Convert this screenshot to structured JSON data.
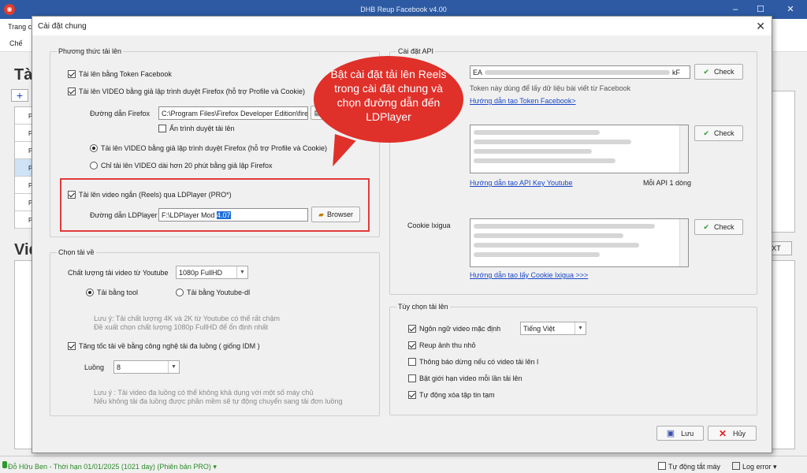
{
  "app": {
    "title": "DHB Reup Facebook v4.00",
    "menu_label": "Trang ch",
    "toolbar_label": "Chế",
    "big_title_1": "Tài",
    "big_title_2": "Vide",
    "left_rows": [
      "P",
      "Pa",
      "Pa",
      "Pa",
      "Pa",
      "Pa",
      "Pa"
    ],
    "right_button_label": "XT"
  },
  "dialog": {
    "title": "Cài đặt chung",
    "upload_method": {
      "group_label": "Phương thức tải lên",
      "token_facebook": "Tải lên bằng Token Facebook",
      "firefox_emulation": "Tải lên VIDEO bằng giả lập trình duyệt Firefox (hỗ trợ Profile và Cookie)",
      "firefox_path_label": "Đường dẫn Firefox",
      "firefox_path_value": "C:\\Program Files\\Firefox Developer Edition\\fire",
      "hide_browser": "Ẩn trình duyệt tải lên",
      "radio_all": "Tải lên VIDEO bằng giả lập trình duyệt Firefox (hỗ trợ Profile và Cookie)",
      "radio_short": "Chỉ tải lên VIDEO dài hơn 20 phút bằng giả lập Firefox",
      "reels_ldplayer": "Tải lên video ngắn (Reels) qua LDPlayer (PRO*)",
      "ldplayer_path_label": "Đường dẫn LDPlayer",
      "ldplayer_path_prefix": "F:\\LDPlayer Mod ",
      "ldplayer_path_selected": "4.07",
      "browser_button": "Browser"
    },
    "download": {
      "group_label": "Chọn tải về",
      "quality_label": "Chất lượng tải video từ Youtube",
      "quality_value": "1080p FullHD",
      "radio_tool": "Tải bằng tool",
      "radio_ytdl": "Tải bằng Youtube-dl",
      "note1_line1": "Lưu ý: Tải chất lượng 4K và 2K từ Youtube có thể rất chậm",
      "note1_line2": "Đề xuất chọn chất lượng 1080p FullHD để ổn định nhất",
      "multithread": "Tăng tốc tải về bằng công nghệ tải đa luồng ( giống IDM )",
      "threads_label": "Luồng",
      "threads_value": "8",
      "note2_line1": "Lưu ý : Tải video đa luồng có thể không khả dụng với một số máy chủ",
      "note2_line2": "Nếu không tải đa luồng được phần mềm sẽ tự động chuyển sang tải đơn luồng"
    },
    "api": {
      "group_label": "Cài đặt API",
      "token_value": "EA",
      "token_tail": "kF",
      "check": "Check",
      "token_note": "Token này dùng để lấy dữ liệu bài viết từ Facebook",
      "token_link": "Hướng dẫn tạo Token Facebook>",
      "youtube_link": "Hướng dẫn tạo API Key Youtube",
      "api_note": "Mỗi API 1 dòng",
      "cookie_label": "Cookie Ixigua",
      "cookie_link": "Hướng dẫn tạo lấy Cookie Ixigua >>>"
    },
    "upload_options": {
      "group_label": "Tùy chọn tải lên",
      "default_lang": "Ngôn ngữ video mặc định",
      "lang_value": "Tiếng Việt",
      "reup_thumb": "Reup ảnh thu nhỏ",
      "stop_notify": "Thông báo dừng nếu có video tải lên l",
      "limit_videos": "Bật giới hạn video mỗi lần tải lên",
      "auto_delete": "Tự động xóa tập tin tạm"
    },
    "save": "Lưu",
    "cancel": "Hủy"
  },
  "callout": {
    "text": "Bật cài đặt tải lên Reels trong cài đặt chung và chọn đường dẫn đến LDPlayer"
  },
  "status": {
    "user": "Đỗ Hữu Ben - Thời hạn 01/01/2025 (1021 day)  (Phiên bản PRO) ▾",
    "auto_shutdown": "Tự động tắt máy",
    "log_error": "Log error ▾"
  }
}
